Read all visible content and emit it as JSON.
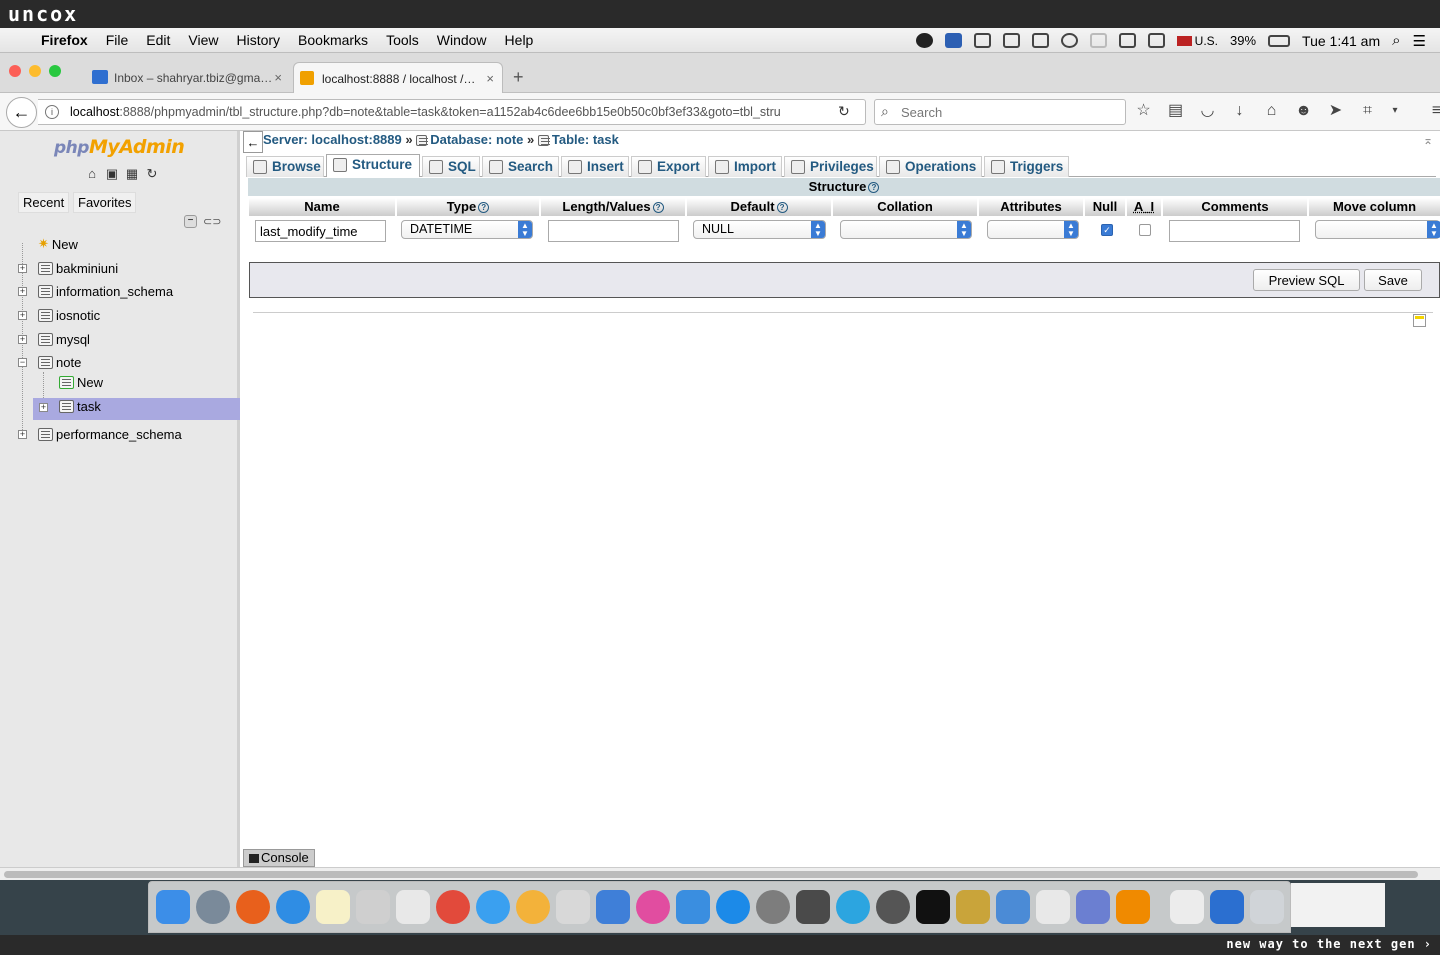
{
  "banner": {
    "top": "uncox",
    "bottom": "new way to the next gen ›"
  },
  "menubar": {
    "app": "Firefox",
    "items": [
      "File",
      "Edit",
      "View",
      "History",
      "Bookmarks",
      "Tools",
      "Window",
      "Help"
    ],
    "keyboard": "U.S.",
    "battery": "39%",
    "clock": "Tue 1:41 am"
  },
  "tabs": [
    {
      "label": "Inbox – shahryar.tbiz@gma…",
      "icon": "mail-icon"
    },
    {
      "label": "localhost:8888 / localhost /…",
      "icon": "pma-icon"
    }
  ],
  "navbar": {
    "url_host": "localhost",
    "url_rest": ":8888/phpmyadmin/tbl_structure.php?db=note&table=task&token=a1152ab4c6dee6bb15e0b50c0bf3ef33&goto=tbl_stru",
    "search_placeholder": "Search"
  },
  "sidebar": {
    "logo_php": "php",
    "logo_rest": "MyAdmin",
    "recent": "Recent",
    "favorites": "Favorites",
    "new": "New",
    "databases": [
      "bakminiuni",
      "information_schema",
      "iosnotic",
      "mysql",
      "note",
      "performance_schema"
    ],
    "note_children": {
      "new": "New",
      "table": "task"
    }
  },
  "breadcrumb": {
    "server": "Server: localhost:8889",
    "database": "Database: note",
    "table": "Table: task",
    "sep": "»"
  },
  "page_tabs": [
    "Browse",
    "Structure",
    "SQL",
    "Search",
    "Insert",
    "Export",
    "Import",
    "Privileges",
    "Operations",
    "Triggers"
  ],
  "active_tab": "Structure",
  "structure": {
    "heading": "Structure",
    "columns": [
      "Name",
      "Type",
      "Length/Values",
      "Default",
      "Collation",
      "Attributes",
      "Null",
      "A_I",
      "Comments",
      "Move column"
    ],
    "row": {
      "name": "last_modify_time",
      "type": "DATETIME",
      "length": "",
      "default": "NULL",
      "collation": "",
      "attributes": "",
      "null_checked": true,
      "ai_checked": false,
      "comments": "",
      "move": ""
    }
  },
  "buttons": {
    "preview_sql": "Preview SQL",
    "save": "Save"
  },
  "console": "Console"
}
